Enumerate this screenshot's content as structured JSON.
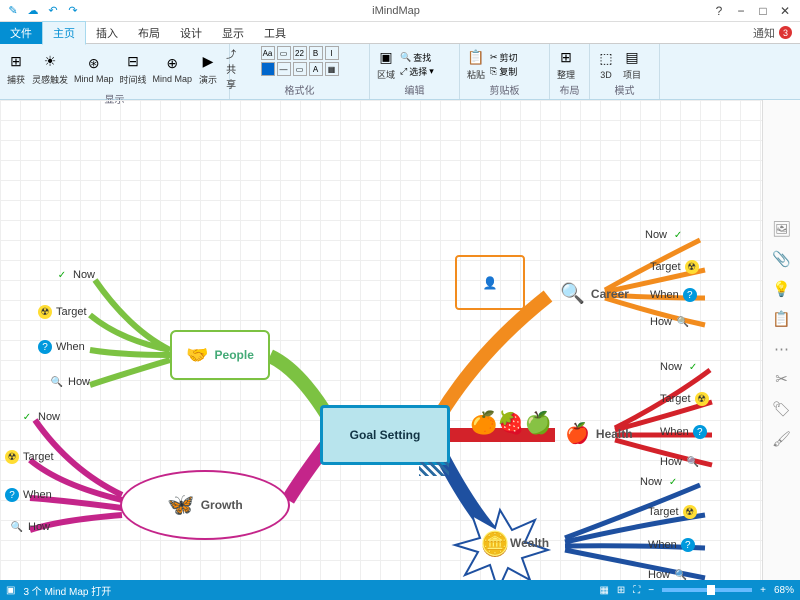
{
  "app": {
    "title": "iMindMap"
  },
  "quicklaunch": [
    "✎",
    "☁",
    "↶",
    "↷"
  ],
  "windowControls": {
    "help": "?",
    "min": "−",
    "max": "□",
    "close": "✕"
  },
  "menu": {
    "file": "文件",
    "tabs": [
      "主页",
      "插入",
      "布局",
      "设计",
      "显示",
      "工具"
    ],
    "activeTab": 0,
    "notif_label": "通知",
    "notif_count": "3"
  },
  "ribbon": {
    "groups": [
      {
        "label": "显示",
        "items": [
          "捕获",
          "灵感触发",
          "Mind Map",
          "时间线",
          "Mind Map",
          "演示"
        ],
        "share": "共享"
      },
      {
        "label": "格式化"
      },
      {
        "label": "编辑",
        "items": [
          "区域",
          "选择",
          "查找"
        ]
      },
      {
        "label": "剪贴板",
        "items": [
          "粘贴",
          "剪切",
          "复制"
        ]
      },
      {
        "label": "布局",
        "items": [
          "整理"
        ]
      },
      {
        "label": "模式",
        "items": [
          "3D",
          "项目"
        ]
      }
    ]
  },
  "mindmap": {
    "center": "Goal Setting",
    "branches": [
      {
        "name": "People",
        "color": "#7cc242"
      },
      {
        "name": "Growth",
        "color": "#c4258a"
      },
      {
        "name": "Career",
        "color": "#f28c1e"
      },
      {
        "name": "Health",
        "color": "#d3222a"
      },
      {
        "name": "Wealth",
        "color": "#1e50a0"
      }
    ],
    "subLabels": [
      "Now",
      "Target",
      "When",
      "How"
    ]
  },
  "toolstrip": [
    "🖼",
    "📎",
    "💡",
    "📋",
    "⋯",
    "✂",
    "🏷",
    "🖌"
  ],
  "status": {
    "left": "3 个 Mind Map 打开",
    "zoom": "68%"
  }
}
